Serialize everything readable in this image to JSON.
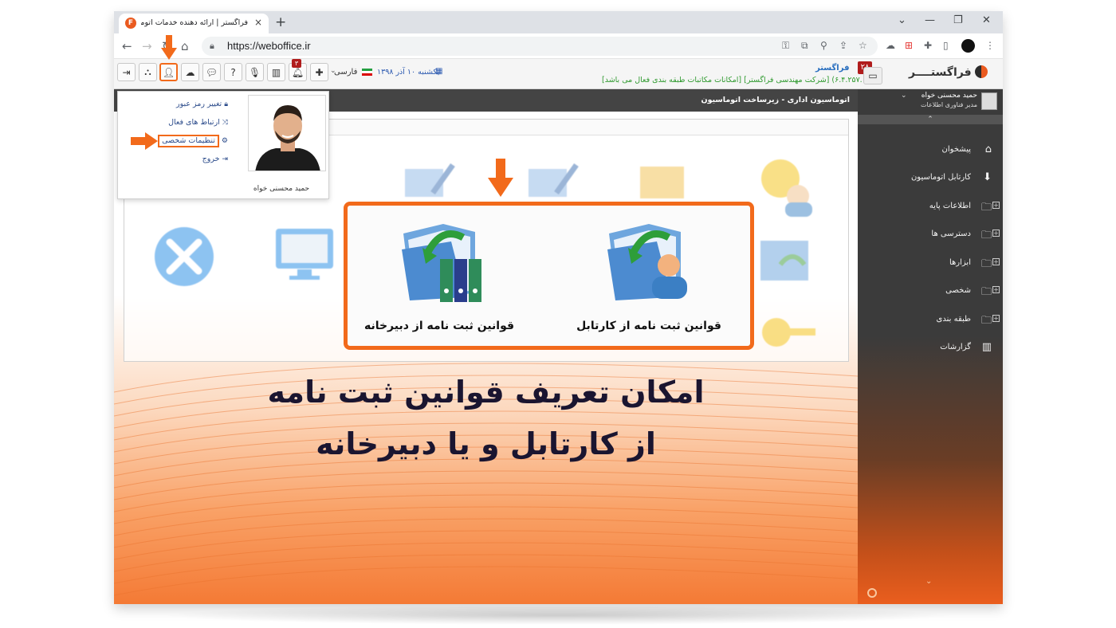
{
  "browser": {
    "tab_title": "فراگستر | ارائه دهنده خدمات اتوماسیون اداری",
    "tab_close": "×",
    "new_tab": "+",
    "url": "https://weboffice.ir",
    "window_controls": [
      "⌄",
      "—",
      "❐",
      "✕"
    ]
  },
  "toolbar": {
    "notification_count": "۳",
    "language": "فارسی",
    "date": "یکشنبه ۱۰ آذر ۱۳۹۸",
    "org_name": "فراگستر",
    "org_subtitle": "(۶.۴.۲۵۷.۱) [شرکت مهندسی فراگستر] [امکانات مکاتبات طبقه بندی فعال می باشد]",
    "inbox_count": "۲۸",
    "logo_text": "فراگستــــر"
  },
  "breadcrumb": "اتوماسیون اداری - زیرساخت اتوماسیون",
  "user_menu": {
    "items": [
      {
        "label": "تغییر رمز عبور",
        "icon": "lock-icon"
      },
      {
        "label": "ارتباط های فعال",
        "icon": "shuffle-icon"
      },
      {
        "label": "تنظیمات شخصی",
        "icon": "gear-icon"
      },
      {
        "label": "خروج",
        "icon": "logout-icon"
      }
    ],
    "user_name": "حمید محسنی خواه"
  },
  "highlight": {
    "item_right": "قوانین ثبت نامه از کارتابل",
    "item_left": "قوانین ثبت نامه از دبیرخانه"
  },
  "headline": {
    "line1": "امکان تعریف قوانین ثبت نامه",
    "line2": "از کارتابل و یا دبیرخانه"
  },
  "sidebar": {
    "user_name": "حمید محسنی خواه",
    "user_role": "مدیر فناوری اطلاعات",
    "items": [
      {
        "label": "پیشخوان",
        "icon": "home-icon",
        "expandable": false
      },
      {
        "label": "کارتابل اتوماسیون",
        "icon": "inbox-icon",
        "expandable": false
      },
      {
        "label": "اطلاعات پایه",
        "icon": "folder-icon",
        "expandable": true
      },
      {
        "label": "دسترسی ها",
        "icon": "folder-icon",
        "expandable": true
      },
      {
        "label": "ابزارها",
        "icon": "folder-icon",
        "expandable": true
      },
      {
        "label": "شخصی",
        "icon": "folder-icon",
        "expandable": true
      },
      {
        "label": "طبقه بندی",
        "icon": "folder-icon",
        "expandable": true
      },
      {
        "label": "گزارشات",
        "icon": "chart-icon",
        "expandable": false
      }
    ]
  },
  "colors": {
    "accent": "#f26a1b",
    "sidebar_dark": "#3b3b3b",
    "headline": "#1a1530"
  }
}
